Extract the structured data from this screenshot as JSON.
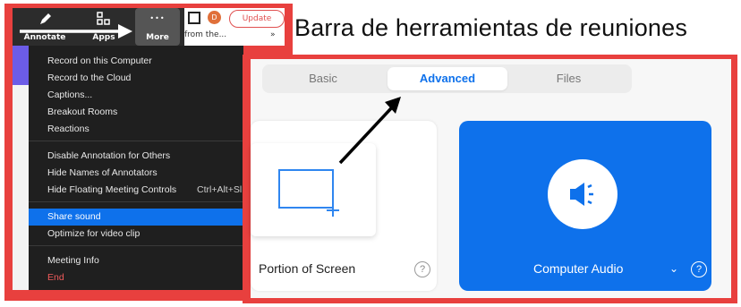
{
  "caption": "Barra de herramientas de reuniones",
  "toolbar": {
    "annotate_label": "Annotate",
    "apps_label": "Apps",
    "more_label": "More",
    "more_dots": "•••",
    "update_label": "Update",
    "profile_initial": "D",
    "tab_snippet": "from the...",
    "overflow": "»"
  },
  "menu": {
    "items": [
      {
        "label": "Record on this Computer"
      },
      {
        "label": "Record to the Cloud"
      },
      {
        "label": "Captions..."
      },
      {
        "label": "Breakout Rooms"
      },
      {
        "label": "Reactions"
      },
      {
        "label": "Disable Annotation for Others"
      },
      {
        "label": "Hide Names of Annotators"
      },
      {
        "label": "Hide Floating Meeting Controls",
        "shortcut": "Ctrl+Alt+Sl"
      },
      {
        "label": "Share sound",
        "active": true
      },
      {
        "label": "Optimize for video clip"
      },
      {
        "label": "Meeting Info"
      },
      {
        "label": "End",
        "danger": true
      }
    ]
  },
  "share": {
    "tabs": [
      {
        "label": "Basic"
      },
      {
        "label": "Advanced",
        "active": true
      },
      {
        "label": "Files"
      }
    ],
    "portion_label": "Portion of Screen",
    "audio_label": "Computer Audio",
    "help": "?",
    "chevron": "⌄"
  },
  "colors": {
    "accent": "#0e71eb",
    "frame": "#e8403e",
    "menu_bg": "#1f1f1f",
    "danger": "#f05a5a"
  }
}
